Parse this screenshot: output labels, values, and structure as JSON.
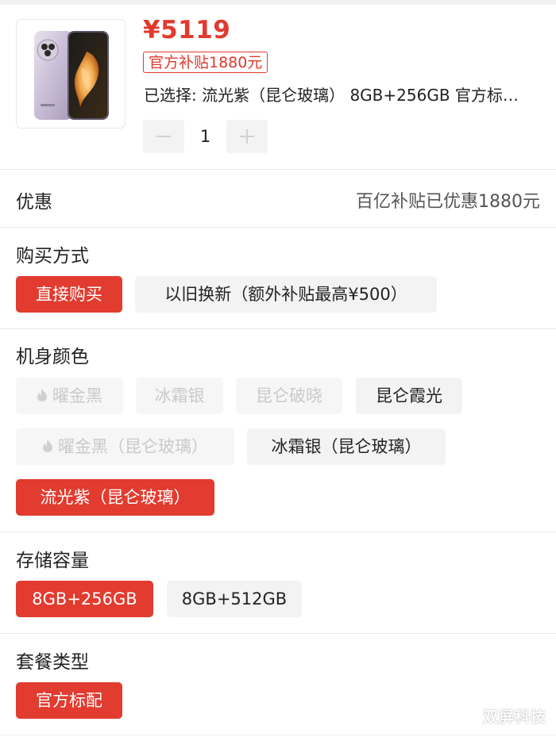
{
  "product": {
    "price": "¥5119",
    "subsidy_tag": "官方补贴1880元",
    "selected_summary": "已选择: 流光紫（昆仑玻璃） 8GB+256GB 官方标…",
    "quantity": "1",
    "image_icon": "phone-product-icon"
  },
  "discount": {
    "title": "优惠",
    "value": "百亿补贴已优惠1880元"
  },
  "purchase_method": {
    "title": "购买方式",
    "options": [
      {
        "label": "直接购买",
        "state": "selected"
      },
      {
        "label": "以旧换新（额外补贴最高¥500）",
        "state": "normal"
      }
    ]
  },
  "color": {
    "title": "机身颜色",
    "options": [
      {
        "label": "曜金黑",
        "state": "disabled",
        "icon": "flame-icon"
      },
      {
        "label": "冰霜银",
        "state": "disabled"
      },
      {
        "label": "昆仑破晓",
        "state": "disabled"
      },
      {
        "label": "昆仑霞光",
        "state": "normal"
      },
      {
        "label": "曜金黑（昆仑玻璃）",
        "state": "disabled",
        "icon": "flame-icon"
      },
      {
        "label": "冰霜银（昆仑玻璃）",
        "state": "normal"
      },
      {
        "label": "流光紫（昆仑玻璃）",
        "state": "selected"
      }
    ]
  },
  "storage": {
    "title": "存储容量",
    "options": [
      {
        "label": "8GB+256GB",
        "state": "selected"
      },
      {
        "label": "8GB+512GB",
        "state": "normal"
      }
    ]
  },
  "package": {
    "title": "套餐类型",
    "options": [
      {
        "label": "官方标配",
        "state": "selected"
      }
    ]
  },
  "watermark": "双屏科技",
  "colors": {
    "accent": "#e23b2f",
    "chip_bg": "#f3f3f3",
    "disabled_text": "#c9c9c9"
  }
}
